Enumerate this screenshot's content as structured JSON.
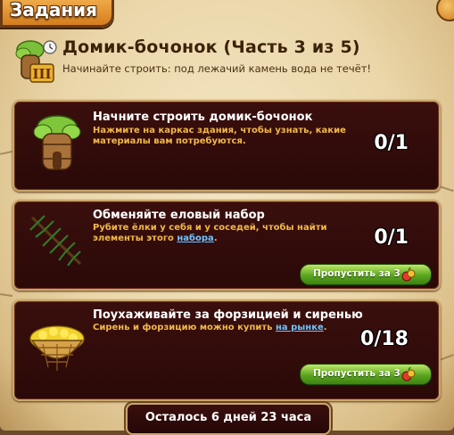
{
  "window": {
    "tab_label": "Задания"
  },
  "quest": {
    "title": "Домик-бочонок (Часть 3 из 5)",
    "subtitle": "Начинайте строить: под лежачий камень вода не течёт!",
    "stage_badge": "III"
  },
  "tasks": [
    {
      "title": "Начните строить домик-бочонок",
      "description": "Нажмите на каркас здания, чтобы узнать, какие материалы вам потребуются.",
      "progress": "0/1",
      "icon": "barrel-house-icon"
    },
    {
      "title": "Обменяйте еловый набор",
      "description_before": "Рубите ёлки у себя и у соседей, чтобы найти элементы этого ",
      "description_link": "набора",
      "description_after": ".",
      "progress": "0/1",
      "skip_label": "Пропустить за 3",
      "icon": "spruce-branch-icon"
    },
    {
      "title": "Поухаживайте за форзицией и сиренью",
      "description_before": "Сирень и форзицию можно купить ",
      "description_link": "на рынке",
      "description_after": ".",
      "progress": "0/18",
      "skip_label": "Пропустить за 3",
      "icon": "flower-basket-icon"
    }
  ],
  "footer": {
    "time_left": "Осталось 6 дней 23 часа"
  },
  "colors": {
    "card_bg": "#2f0b0a",
    "desc_text": "#f2b84a",
    "link": "#6fc3ff",
    "skip_button": "#5aa51e",
    "tab": "#e08a26"
  }
}
